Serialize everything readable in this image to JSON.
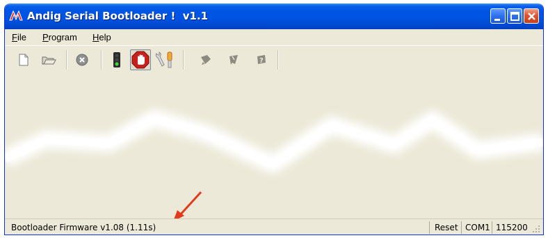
{
  "window": {
    "title": "Andig Serial Bootloader !  v1.1",
    "title_color": "#ffffff",
    "titlebar_color": "#0055e5"
  },
  "menu": {
    "items": [
      {
        "label": "File",
        "accel": "F"
      },
      {
        "label": "Program",
        "accel": "P"
      },
      {
        "label": "Help",
        "accel": "H"
      }
    ]
  },
  "toolbar": {
    "buttons": [
      {
        "icon": "new-document-icon",
        "enabled": true
      },
      {
        "icon": "open-folder-icon",
        "enabled": true
      },
      {
        "icon": "stop-circle-icon",
        "enabled": true
      },
      {
        "icon": "traffic-light-icon",
        "enabled": true
      },
      {
        "icon": "stop-hand-icon",
        "enabled": true,
        "pressed": true
      },
      {
        "icon": "wrench-settings-icon",
        "enabled": true
      },
      {
        "icon": "program-chip-icon",
        "enabled": false
      },
      {
        "icon": "verify-icon",
        "enabled": false
      },
      {
        "icon": "help-icon",
        "enabled": false
      }
    ]
  },
  "status": {
    "firmware": "Bootloader Firmware v1.08 (1.11s)",
    "reset": "Reset",
    "port": "COM1",
    "baud": "115200"
  },
  "annotation": {
    "arrow_color": "#e23a1e"
  }
}
